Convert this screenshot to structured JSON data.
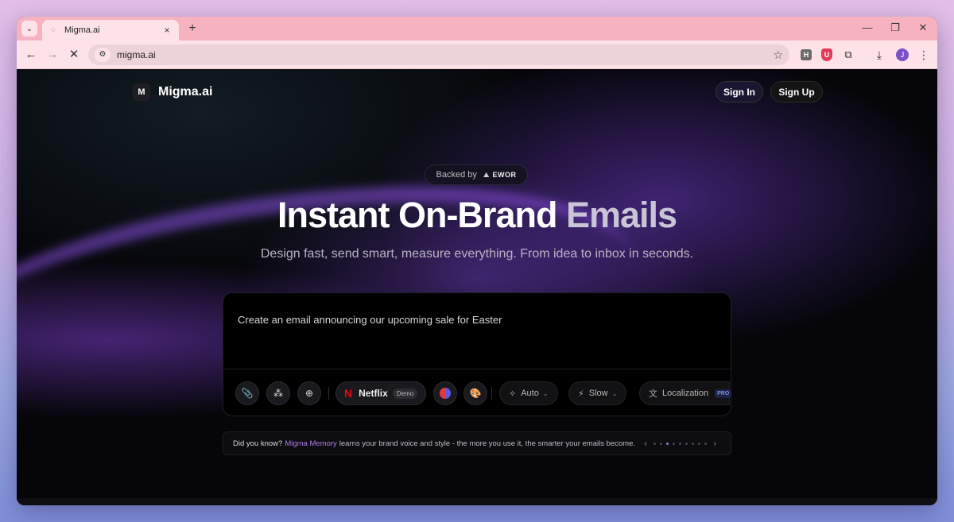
{
  "browser": {
    "tab_title": "Migma.ai",
    "url": "migma.ai",
    "new_tab_symbol": "+",
    "tab_close_symbol": "×",
    "avatar_letter": "J",
    "extensions": [
      "H",
      "U",
      "puzzle-icon"
    ]
  },
  "header": {
    "logo_mark": "M",
    "logo_text": "Migma.ai",
    "sign_in": "Sign In",
    "sign_up": "Sign Up"
  },
  "hero": {
    "backed_by": "Backed by",
    "backer": "EWOR",
    "title_main": "Instant On-Brand ",
    "title_accent": "Emails",
    "subtitle": "Design fast, send smart, measure everything. From idea to inbox in seconds."
  },
  "prompt": {
    "text": "Create an email announcing our upcoming sale for Easter",
    "brand_logo": "N",
    "brand_name": "Netflix",
    "brand_badge": "Demo",
    "model": "Auto",
    "speed": "Slow",
    "localization": "Localization",
    "pro_badge": "PRO"
  },
  "tip": {
    "lead": "Did you know?",
    "highlight": "Migma Memory",
    "rest": "learns your brand voice and style - the more you use it, the smarter your emails become.",
    "dots_total": 9,
    "active_dot": 2
  },
  "colors": {
    "accent_purple": "#b07be6",
    "netflix_red": "#e50914",
    "tab_strip": "#f6b3bf"
  }
}
